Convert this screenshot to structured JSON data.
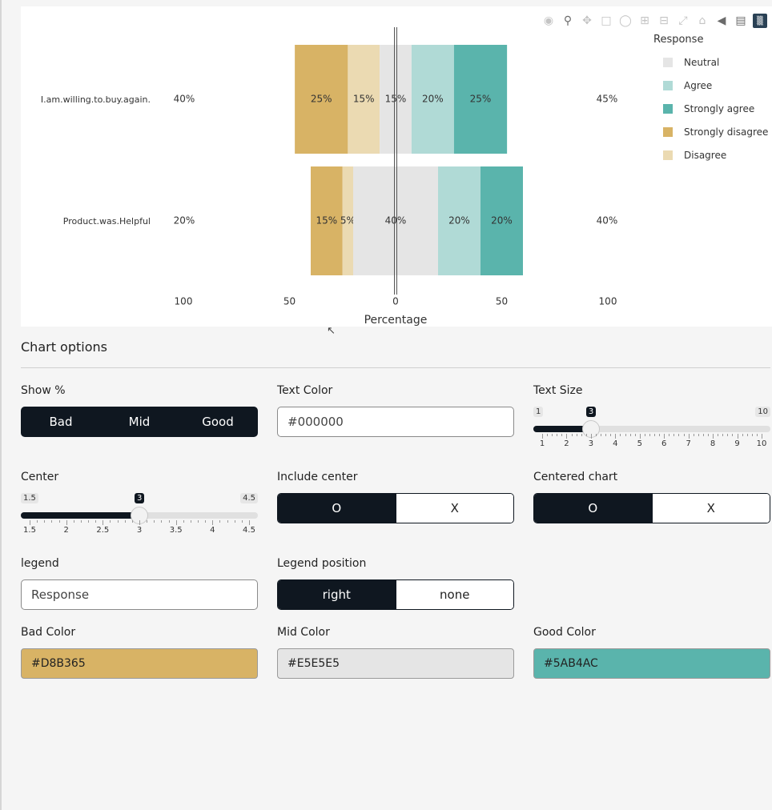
{
  "chart_data": {
    "type": "bar",
    "orientation": "horizontal",
    "barmode": "diverging-stacked",
    "categories": [
      "I.am.willing.to.buy.again.",
      "Product.was.Helpful"
    ],
    "series": [
      {
        "name": "Strongly disagree",
        "values": [
          25,
          15
        ],
        "color": "#D8B365"
      },
      {
        "name": "Disagree",
        "values": [
          15,
          5
        ],
        "color": "#EBDAB2"
      },
      {
        "name": "Neutral",
        "values": [
          15,
          40
        ],
        "color": "#E5E5E5"
      },
      {
        "name": "Agree",
        "values": [
          20,
          20
        ],
        "color": "#B0DAD6"
      },
      {
        "name": "Strongly agree",
        "values": [
          25,
          20
        ],
        "color": "#5AB4AC"
      }
    ],
    "bar_labels": [
      [
        "25%",
        "15%",
        "15%",
        "20%",
        "25%"
      ],
      [
        "15%",
        "5%",
        "40%",
        "20%",
        "20%"
      ]
    ],
    "left_totals": [
      "40%",
      "20%"
    ],
    "right_totals": [
      "45%",
      "40%"
    ],
    "xlabel": "Percentage",
    "xlim": [
      -100,
      100
    ],
    "x_ticks": [
      -100,
      -50,
      0,
      50,
      100
    ],
    "x_tick_labels": [
      "100",
      "50",
      "0",
      "50",
      "100"
    ],
    "legend": {
      "title": "Response",
      "position": "top-right",
      "order": [
        "Neutral",
        "Agree",
        "Strongly agree",
        "Strongly disagree",
        "Disagree"
      ]
    }
  },
  "modebar": {
    "icons": [
      "camera-icon",
      "zoom-icon",
      "pan-icon",
      "box-select-icon",
      "lasso-icon",
      "zoom-in-icon",
      "zoom-out-icon",
      "autoscale-icon",
      "reset-axes-icon",
      "spike-lines-icon",
      "compare-hover-icon",
      "plotly-logo-icon"
    ]
  },
  "options": {
    "title": "Chart options",
    "show_pct": {
      "label": "Show %",
      "options": [
        "Bad",
        "Mid",
        "Good"
      ]
    },
    "text_color": {
      "label": "Text Color",
      "value": "#000000"
    },
    "text_size": {
      "label": "Text Size",
      "min": "1",
      "max": "10",
      "value": "3",
      "value_num": 3,
      "ticks": [
        "1",
        "2",
        "3",
        "4",
        "5",
        "6",
        "7",
        "8",
        "9",
        "10"
      ]
    },
    "center": {
      "label": "Center",
      "min": "1.5",
      "max": "4.5",
      "value": "3",
      "value_num": 3,
      "ticks": [
        "1.5",
        "2",
        "2.5",
        "3",
        "3.5",
        "4",
        "4.5"
      ]
    },
    "include_center": {
      "label": "Include center",
      "options": [
        "O",
        "X"
      ],
      "selected": "O"
    },
    "centered_chart": {
      "label": "Centered chart",
      "options": [
        "O",
        "X"
      ],
      "selected": "O"
    },
    "legend": {
      "label": "legend",
      "value": "Response"
    },
    "legend_position": {
      "label": "Legend position",
      "options": [
        "right",
        "none"
      ],
      "selected": "right"
    },
    "bad_color": {
      "label": "Bad Color",
      "value": "#D8B365"
    },
    "mid_color": {
      "label": "Mid Color",
      "value": "#E5E5E5"
    },
    "good_color": {
      "label": "Good Color",
      "value": "#5AB4AC"
    }
  }
}
